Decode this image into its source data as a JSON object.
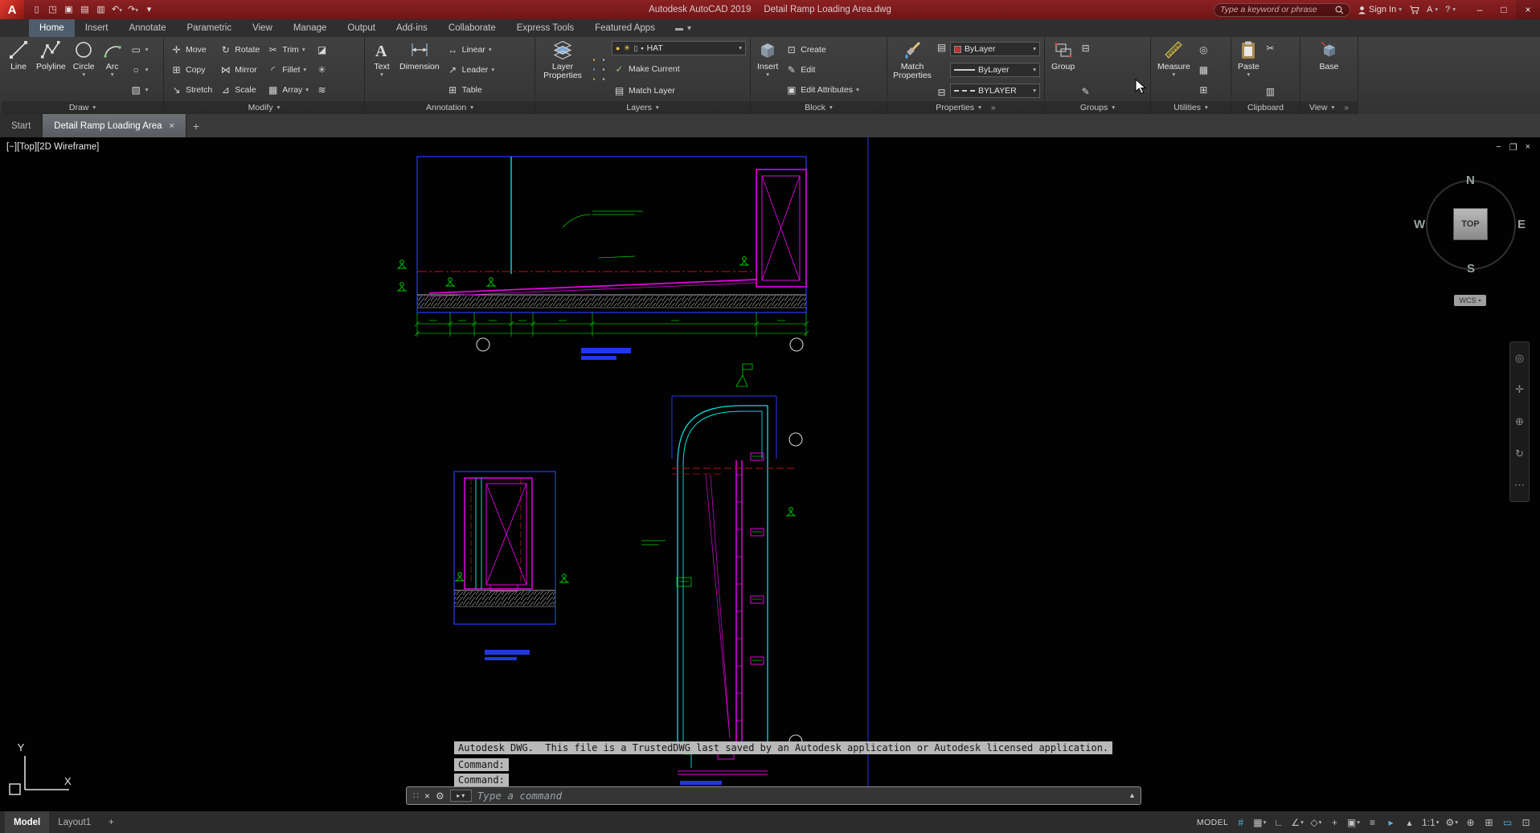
{
  "titlebar": {
    "app_name": "Autodesk AutoCAD 2019",
    "doc_name": "Detail Ramp Loading Area.dwg",
    "search_placeholder": "Type a keyword or phrase",
    "sign_in": "Sign In"
  },
  "ribbon_tabs": {
    "items": [
      {
        "label": "Home"
      },
      {
        "label": "Insert"
      },
      {
        "label": "Annotate"
      },
      {
        "label": "Parametric"
      },
      {
        "label": "View"
      },
      {
        "label": "Manage"
      },
      {
        "label": "Output"
      },
      {
        "label": "Add-ins"
      },
      {
        "label": "Collaborate"
      },
      {
        "label": "Express Tools"
      },
      {
        "label": "Featured Apps"
      }
    ]
  },
  "ribbon": {
    "draw": {
      "label": "Draw",
      "line": "Line",
      "polyline": "Polyline",
      "circle": "Circle",
      "arc": "Arc"
    },
    "modify": {
      "label": "Modify",
      "move": "Move",
      "copy": "Copy",
      "stretch": "Stretch",
      "rotate": "Rotate",
      "mirror": "Mirror",
      "scale": "Scale",
      "trim": "Trim",
      "fillet": "Fillet",
      "array": "Array"
    },
    "annotation": {
      "label": "Annotation",
      "text": "Text",
      "dimension": "Dimension",
      "linear": "Linear",
      "leader": "Leader",
      "table": "Table"
    },
    "layers": {
      "label": "Layers",
      "layer_properties": "Layer Properties",
      "current_layer": "HAT",
      "make_current": "Make Current",
      "match_layer": "Match Layer"
    },
    "block": {
      "label": "Block",
      "insert": "Insert",
      "create": "Create",
      "edit": "Edit",
      "edit_attributes": "Edit Attributes"
    },
    "properties": {
      "label": "Properties",
      "match_properties": "Match Properties",
      "color": "ByLayer",
      "lineweight": "ByLayer",
      "linetype": "BYLAYER"
    },
    "groups": {
      "label": "Groups",
      "group": "Group"
    },
    "utilities": {
      "label": "Utilities",
      "measure": "Measure"
    },
    "clipboard": {
      "label": "Clipboard",
      "paste": "Paste"
    },
    "view": {
      "label": "View",
      "base": "Base"
    }
  },
  "file_tabs": {
    "start": "Start",
    "active_doc": "Detail Ramp Loading Area"
  },
  "viewport": {
    "label": "[−][Top][2D Wireframe]",
    "viewcube": {
      "n": "N",
      "s": "S",
      "e": "E",
      "w": "W",
      "top": "TOP",
      "wcs": "WCS"
    },
    "ucs": {
      "x": "X",
      "y": "Y"
    }
  },
  "command_line": {
    "history": [
      "Autodesk DWG.  This file is a TrustedDWG last saved by an Autodesk application or Autodesk licensed application.",
      "Command:",
      "Command:"
    ],
    "input_placeholder": "Type a command"
  },
  "status_bar": {
    "model_tab": "Model",
    "layout_tab": "Layout1",
    "new_layout": "+",
    "space": "MODEL",
    "scale": "1:1"
  },
  "colors": {
    "titlebar_red": "#7c191b",
    "ribbon_bg": "#3a3a3a",
    "canvas_bg": "#020202",
    "drawing_blue": "#2136e8",
    "drawing_cyan": "#00e0e0",
    "drawing_magenta": "#e100e1",
    "drawing_green": "#00cd00",
    "drawing_red": "#b81414",
    "status_accent": "#5fb2e4"
  }
}
